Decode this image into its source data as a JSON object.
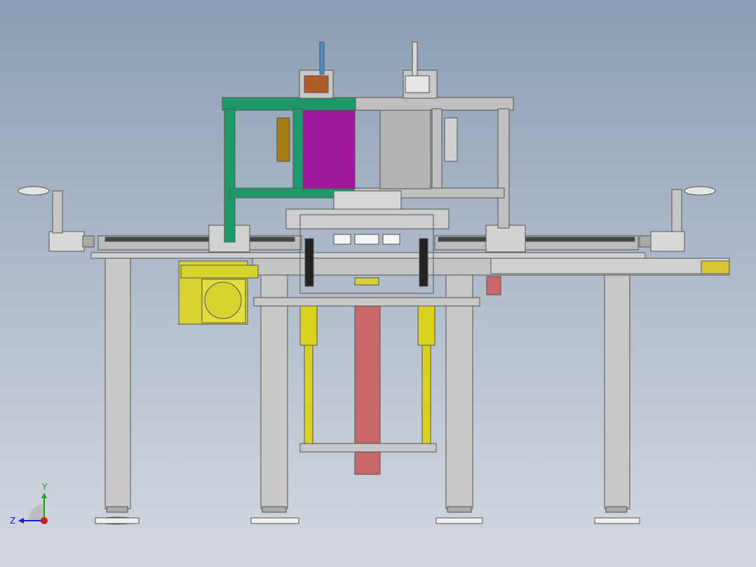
{
  "viewport": {
    "background_top": "#8c9db3",
    "background_bottom": "#d2d7df"
  },
  "model": {
    "parts": {
      "frame": "#c8c8c8",
      "frame_edge": "#555555",
      "green_bracket": "#1e9a6a",
      "magenta_block": "#a0189c",
      "gray_block": "#b4b4b4",
      "yellow_motor": "#d6d230",
      "yellow_cylinder": "#d8d21e",
      "red_column": "#c8686c",
      "blue_rod": "#4a8cd0",
      "brown_hub": "#b05a28",
      "olive_clamp": "#a67c14",
      "black_rail": "#222222"
    }
  },
  "triad": {
    "y_label": "Y",
    "z_label": "Z",
    "y_color": "#19a019",
    "z_color": "#1c1cd2",
    "x_color": "#d21c1c"
  }
}
